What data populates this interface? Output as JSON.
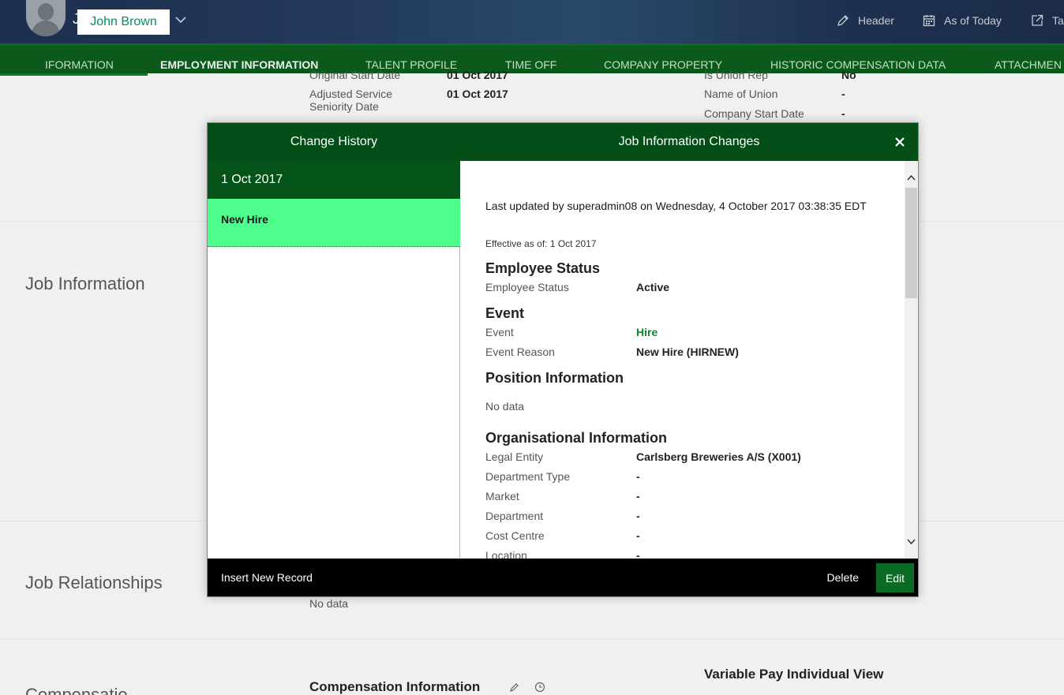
{
  "header": {
    "avatar_initial": "J",
    "user_name": "John Brown",
    "actions": [
      {
        "label": "Header",
        "icon": "pencil-icon"
      },
      {
        "label": "As of Today",
        "icon": "calendar-icon"
      },
      {
        "label": "Ta",
        "icon": "share-icon"
      }
    ]
  },
  "tabs": [
    {
      "label": "IFORMATION"
    },
    {
      "label": "EMPLOYMENT INFORMATION",
      "active": true
    },
    {
      "label": "TALENT PROFILE"
    },
    {
      "label": "TIME OFF"
    },
    {
      "label": "COMPANY PROPERTY"
    },
    {
      "label": "HISTORIC COMPENSATION DATA"
    },
    {
      "label": "ATTACHMEN"
    }
  ],
  "background": {
    "fields_left": [
      {
        "label": "Original Start Date",
        "value": "01 Oct 2017"
      },
      {
        "label": "Adjusted Service Seniority Date",
        "value": "01 Oct 2017"
      }
    ],
    "fields_right": [
      {
        "label": "Is Union Rep",
        "value": "No"
      },
      {
        "label": "Name of Union",
        "value": "-"
      },
      {
        "label": "Company Start Date",
        "value": "-"
      }
    ],
    "sections": {
      "job_information": "Job Information",
      "job_relationships": "Job Relationships",
      "no_data": "No data",
      "compensation_information": "Compensation Information",
      "variable_pay": "Variable Pay Individual View",
      "compensation_partial": "Compensatio"
    }
  },
  "dialog": {
    "left_title": "Change History",
    "history": [
      {
        "date": "1 Oct 2017",
        "items": [
          "New Hire"
        ]
      }
    ],
    "insert_label": "Insert New Record",
    "right_title": "Job Information Changes",
    "last_updated": "Last updated by superadmin08 on Wednesday, 4 October 2017 03:38:35 EDT",
    "effective": "Effective as of: 1 Oct 2017",
    "sections": {
      "employee_status": {
        "title": "Employee Status",
        "fields": [
          {
            "label": "Employee Status",
            "value": "Active"
          }
        ]
      },
      "event": {
        "title": "Event",
        "fields": [
          {
            "label": "Event",
            "value": "Hire"
          },
          {
            "label": "Event Reason",
            "value": "New Hire (HIRNEW)"
          }
        ]
      },
      "position": {
        "title": "Position Information",
        "no_data": "No data"
      },
      "organisational": {
        "title": "Organisational Information",
        "fields": [
          {
            "label": "Legal Entity",
            "value": "Carlsberg Breweries A/S (X001)"
          },
          {
            "label": "Department Type",
            "value": "-"
          },
          {
            "label": "Market",
            "value": "-"
          },
          {
            "label": "Department",
            "value": "-"
          },
          {
            "label": "Cost Centre",
            "value": "-"
          },
          {
            "label": "Location",
            "value": "-"
          }
        ]
      }
    },
    "delete_label": "Delete",
    "edit_label": "Edit",
    "colors": {
      "header_green": "#044f18",
      "selected_item": "#4efe8c",
      "hire_green": "#0a8a2e"
    }
  }
}
